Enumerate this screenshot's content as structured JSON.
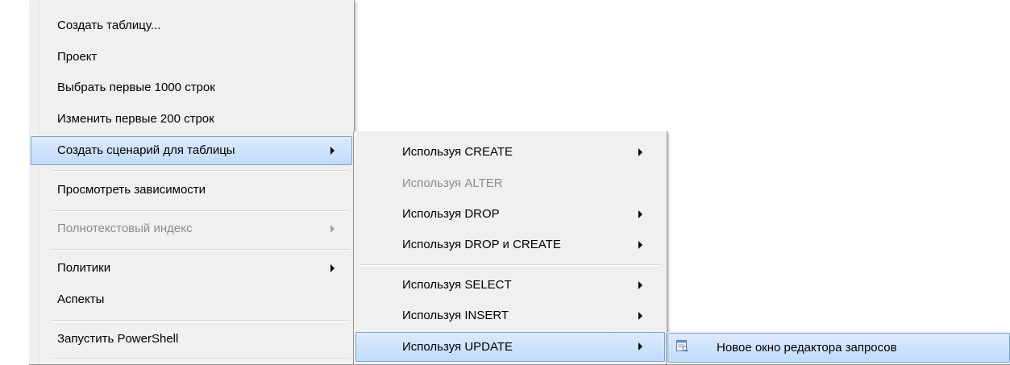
{
  "menu_main": {
    "items": [
      {
        "label": "Создать таблицу...",
        "disabled": false,
        "submenu": false
      },
      {
        "label": "Проект",
        "disabled": false,
        "submenu": false
      },
      {
        "label": "Выбрать первые 1000 строк",
        "disabled": false,
        "submenu": false
      },
      {
        "label": "Изменить первые 200 строк",
        "disabled": false,
        "submenu": false
      },
      {
        "label": "Создать сценарий для таблицы",
        "disabled": false,
        "submenu": true,
        "highlighted": true
      },
      {
        "label": "Просмотреть зависимости",
        "disabled": false,
        "submenu": false
      },
      {
        "label": "Полнотекстовый индекс",
        "disabled": true,
        "submenu": true
      },
      {
        "label": "Политики",
        "disabled": false,
        "submenu": true
      },
      {
        "label": "Аспекты",
        "disabled": false,
        "submenu": false
      },
      {
        "label": "Запустить PowerShell",
        "disabled": false,
        "submenu": false
      }
    ]
  },
  "menu_script": {
    "items": [
      {
        "label": "Используя CREATE",
        "disabled": false,
        "submenu": true
      },
      {
        "label": "Используя ALTER",
        "disabled": true,
        "submenu": false
      },
      {
        "label": "Используя DROP",
        "disabled": false,
        "submenu": true
      },
      {
        "label": "Используя DROP и CREATE",
        "disabled": false,
        "submenu": true
      },
      {
        "label": "Используя SELECT",
        "disabled": false,
        "submenu": true
      },
      {
        "label": "Используя INSERT",
        "disabled": false,
        "submenu": true
      },
      {
        "label": "Используя UPDATE",
        "disabled": false,
        "submenu": true,
        "highlighted": true
      }
    ]
  },
  "menu_update": {
    "items": [
      {
        "label": "Новое окно редактора запросов",
        "icon": "query-editor-window-icon",
        "highlighted": true
      }
    ]
  },
  "colors": {
    "menu_bg": "#f0f0f0",
    "highlight_top": "#dcebfc",
    "highlight_bottom": "#c1dbfc",
    "highlight_border": "#7da2ce",
    "disabled_text": "#8d8d8d"
  }
}
